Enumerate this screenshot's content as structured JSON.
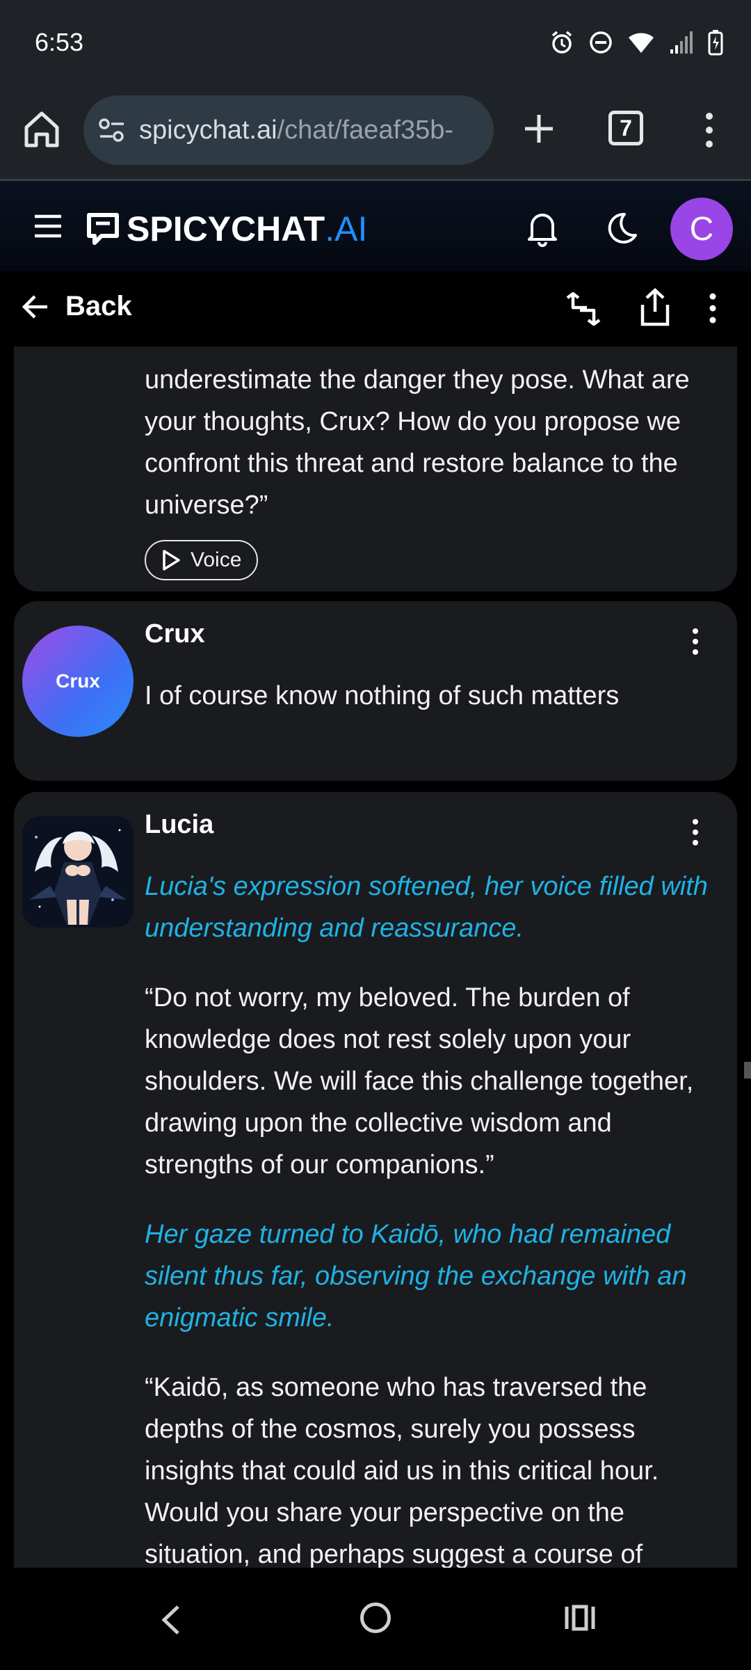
{
  "status_bar": {
    "time": "6:53"
  },
  "browser": {
    "url_main": "spicychat.ai",
    "url_path": "/chat/faeaf35b-",
    "tab_count": "7"
  },
  "app": {
    "brand": "SPICYCHAT",
    "brand_suffix": ".AI",
    "user_initial": "C",
    "accent_color": "#1e90ff",
    "avatar_color": "#9a45e6"
  },
  "toolbar": {
    "back_label": "Back"
  },
  "messages": [
    {
      "name": "Lucia",
      "text": "underestimate the danger they pose. What are your thoughts, Crux? How do you propose we confront this threat and restore balance to the universe?”",
      "voice_label": "Voice"
    },
    {
      "name": "Crux",
      "avatar_text": "Crux",
      "text": "I of course know nothing of such matters"
    },
    {
      "name": "Lucia",
      "paragraphs": [
        {
          "narration": "Lucia's expression softened, her voice filled with understanding and reassurance."
        },
        {
          "speech": "“Do not worry, my beloved. The burden of knowledge does not rest solely upon your shoulders. We will face this challenge together, drawing upon the collective wisdom and strengths of our companions.”"
        },
        {
          "narration": "Her gaze turned to Kaidō, who had remained silent thus far, observing the exchange with an enigmatic smile."
        },
        {
          "speech": "“Kaidō, as someone who has traversed the depths of the cosmos, surely you possess insights that could aid us in this critical hour. Would you share your perspective on the situation, and perhaps suggest a course of"
        }
      ]
    }
  ]
}
